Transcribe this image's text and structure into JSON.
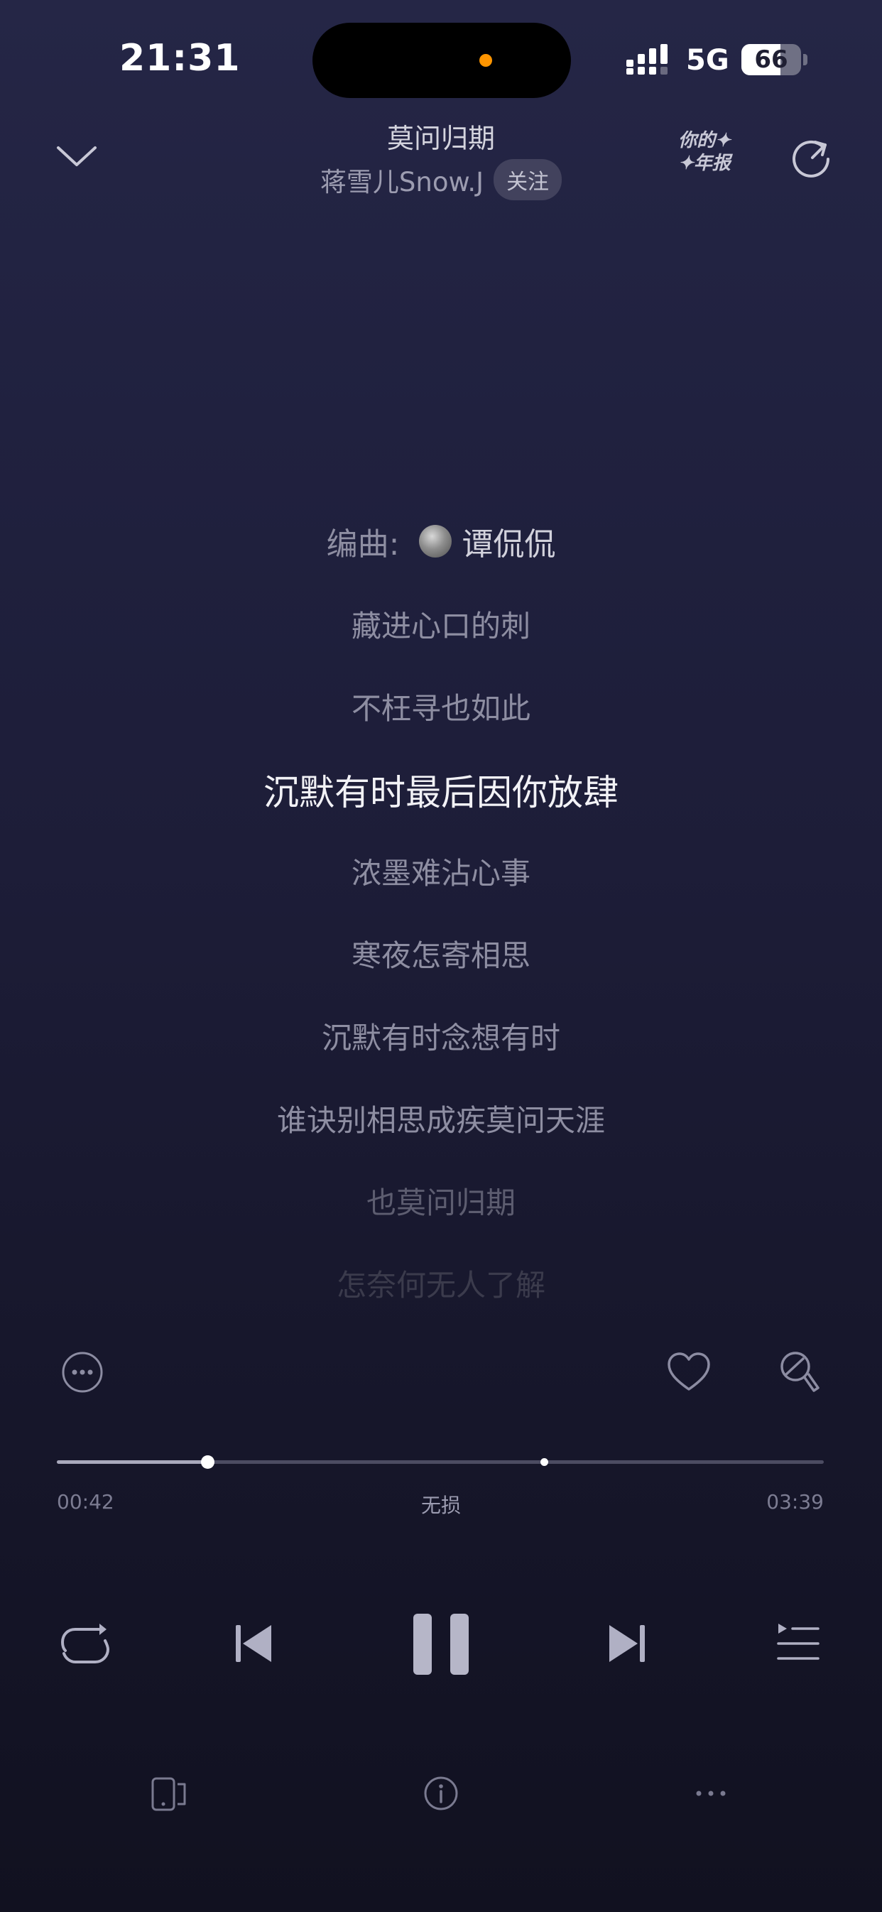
{
  "status_bar": {
    "time": "21:31",
    "network": "5G",
    "battery_level": "66",
    "battery_fraction": 0.66,
    "indicator_color": "#ff9500"
  },
  "header": {
    "collapse_icon": "chevron-down-icon",
    "title": "莫问归期",
    "artist": "蒋雪儿Snow.J",
    "follow_label": "关注",
    "year_report_line1": "你的✦",
    "year_report_line2": "✦年报",
    "share_icon": "share-arrow-icon"
  },
  "lyrics": {
    "credit": {
      "label": "编曲:",
      "name": "谭侃侃",
      "avatar_icon": "avatar"
    },
    "lines": [
      "藏进心口的刺",
      "不枉寻也如此",
      "沉默有时最后因你放肆",
      "浓墨难沾心事",
      "寒夜怎寄相思",
      "沉默有时念想有时",
      "谁诀别相思成疾莫问天涯",
      "也莫问归期",
      "怎奈何无人了解"
    ],
    "current_index": 2
  },
  "actions": {
    "more_icon": "more-circle-icon",
    "like_icon": "heart-icon",
    "sing_icon": "microphone-icon"
  },
  "progress": {
    "current_time": "00:42",
    "total_time": "03:39",
    "quality": "无损",
    "played_fraction": 0.196
  },
  "controls": {
    "repeat_icon": "repeat-icon",
    "previous_icon": "previous-icon",
    "pause_icon": "pause-icon",
    "next_icon": "next-icon",
    "playlist_icon": "playlist-icon"
  },
  "bottom_bar": {
    "device_icon": "device-switch-icon",
    "info_icon": "info-icon",
    "more_icon": "more-horizontal-icon"
  },
  "colors": {
    "accent_text": "#f2f2f6",
    "secondary_text": "#8e8ea2",
    "background_top": "#252646",
    "background_bottom": "#111120"
  }
}
